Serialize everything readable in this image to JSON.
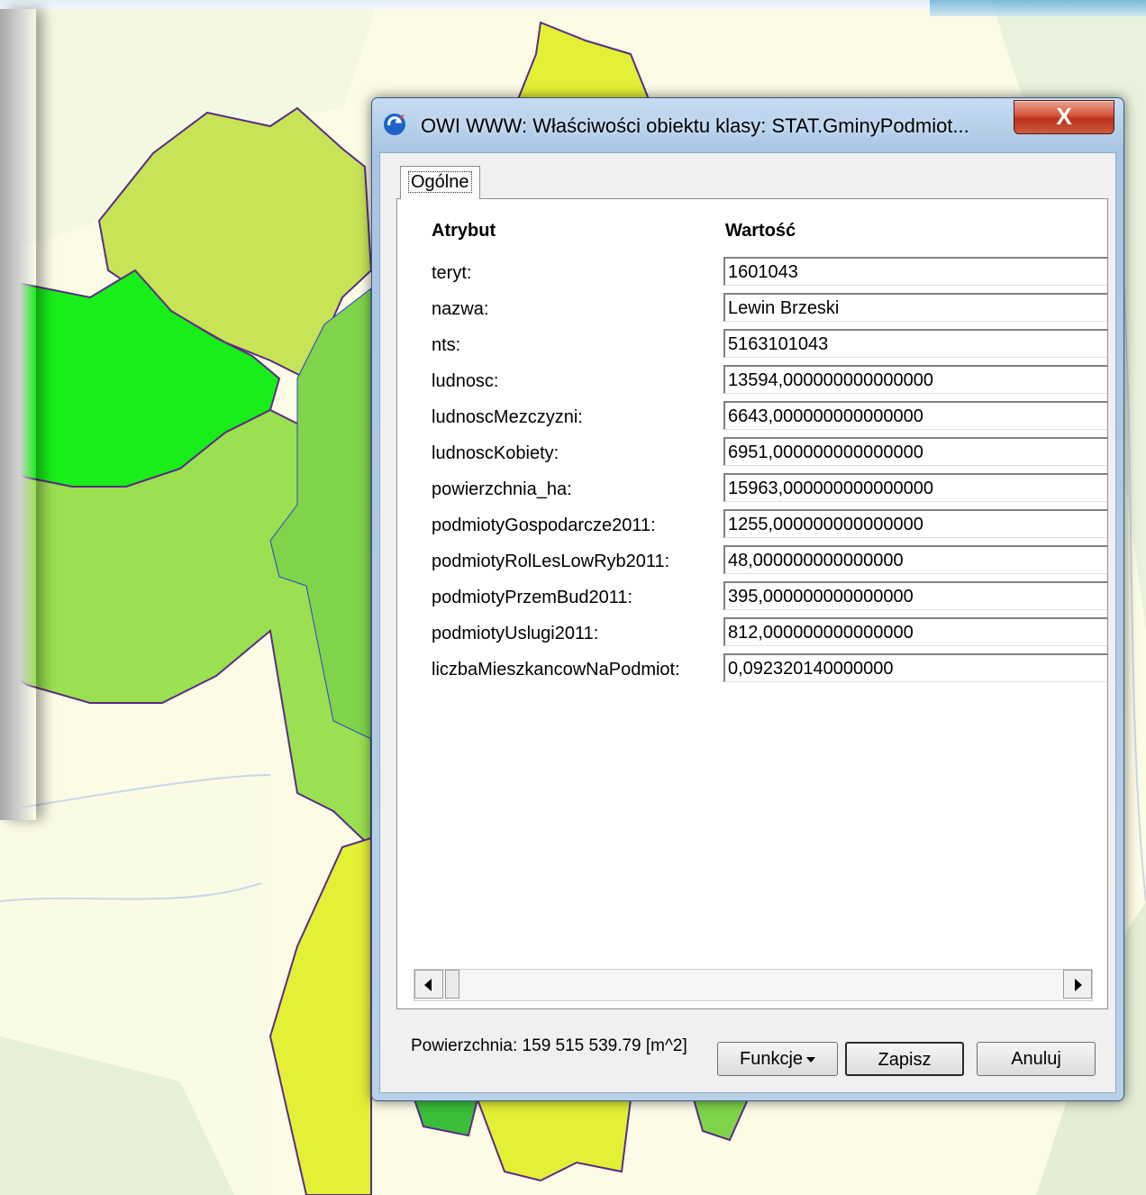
{
  "dialog": {
    "title": "OWI WWW: Właściwości obiektu klasy: STAT.GminyPodmiot...",
    "close_label": "X",
    "tab_label": "Ogólne",
    "header_attribute": "Atrybut",
    "header_value": "Wartość",
    "rows": [
      {
        "label": "teryt:",
        "value": "1601043"
      },
      {
        "label": "nazwa:",
        "value": "Lewin Brzeski"
      },
      {
        "label": "nts:",
        "value": "5163101043"
      },
      {
        "label": "ludnosc:",
        "value": "13594,000000000000000"
      },
      {
        "label": "ludnoscMezczyzni:",
        "value": "6643,000000000000000"
      },
      {
        "label": "ludnoscKobiety:",
        "value": "6951,000000000000000"
      },
      {
        "label": "powierzchnia_ha:",
        "value": "15963,000000000000000"
      },
      {
        "label": "podmiotyGospodarcze2011:",
        "value": "1255,000000000000000"
      },
      {
        "label": "podmiotyRolLesLowRyb2011:",
        "value": "48,000000000000000"
      },
      {
        "label": "podmiotyPrzemBud2011:",
        "value": "395,000000000000000"
      },
      {
        "label": "podmiotyUslugi2011:",
        "value": "812,000000000000000"
      },
      {
        "label": "liczbaMieszkancowNaPodmiot:",
        "value": "0,092320140000000"
      }
    ],
    "area_text": "Powierzchnia: 159 515 539.79 [m^2]",
    "buttons": {
      "funkcje": "Funkcje",
      "zapisz": "Zapisz",
      "anuluj": "Anuluj"
    }
  },
  "map": {
    "colors": {
      "background": "#fbfbe6",
      "light_green": "#c7e356",
      "bright_green": "#18ee18",
      "mid_green": "#9be050",
      "dark_green": "#3bbf3b",
      "yellow": "#e3f036",
      "boundary": "#5a2d82",
      "water": "#2b3fd6"
    }
  }
}
